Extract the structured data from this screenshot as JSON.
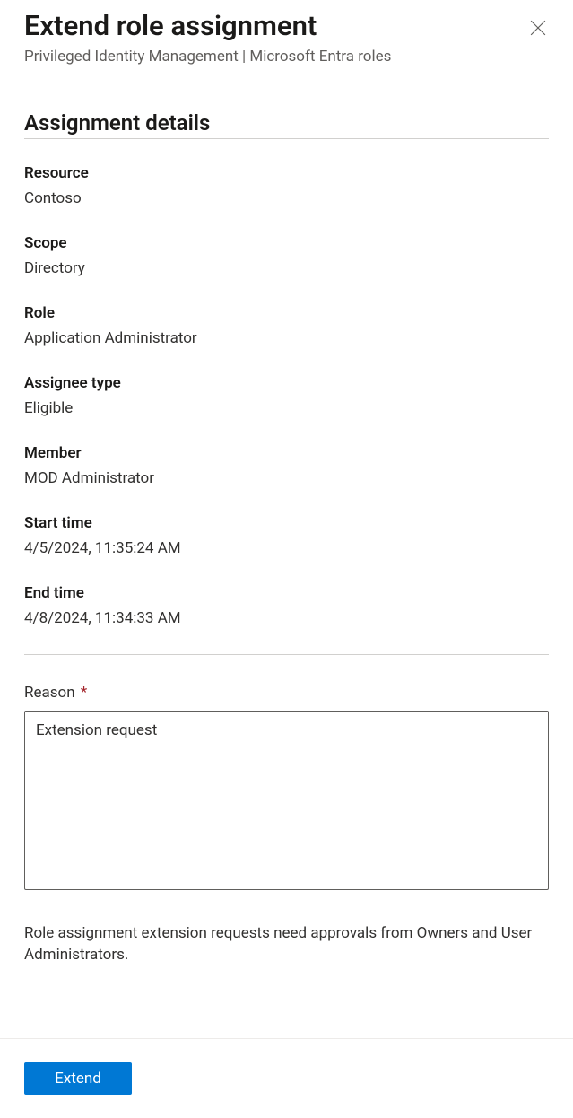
{
  "header": {
    "title": "Extend role assignment",
    "subtitle": "Privileged Identity Management | Microsoft Entra roles"
  },
  "section_heading": "Assignment details",
  "details": {
    "resource": {
      "label": "Resource",
      "value": "Contoso"
    },
    "scope": {
      "label": "Scope",
      "value": "Directory"
    },
    "role": {
      "label": "Role",
      "value": "Application Administrator"
    },
    "assignee_type": {
      "label": "Assignee type",
      "value": "Eligible"
    },
    "member": {
      "label": "Member",
      "value": "MOD Administrator"
    },
    "start_time": {
      "label": "Start time",
      "value": "4/5/2024, 11:35:24 AM"
    },
    "end_time": {
      "label": "End time",
      "value": "4/8/2024, 11:34:33 AM"
    }
  },
  "reason": {
    "label": "Reason",
    "required_mark": "*",
    "value": "Extension request"
  },
  "helper_text": "Role assignment extension requests need approvals from Owners and User Administrators.",
  "footer": {
    "extend_label": "Extend"
  }
}
